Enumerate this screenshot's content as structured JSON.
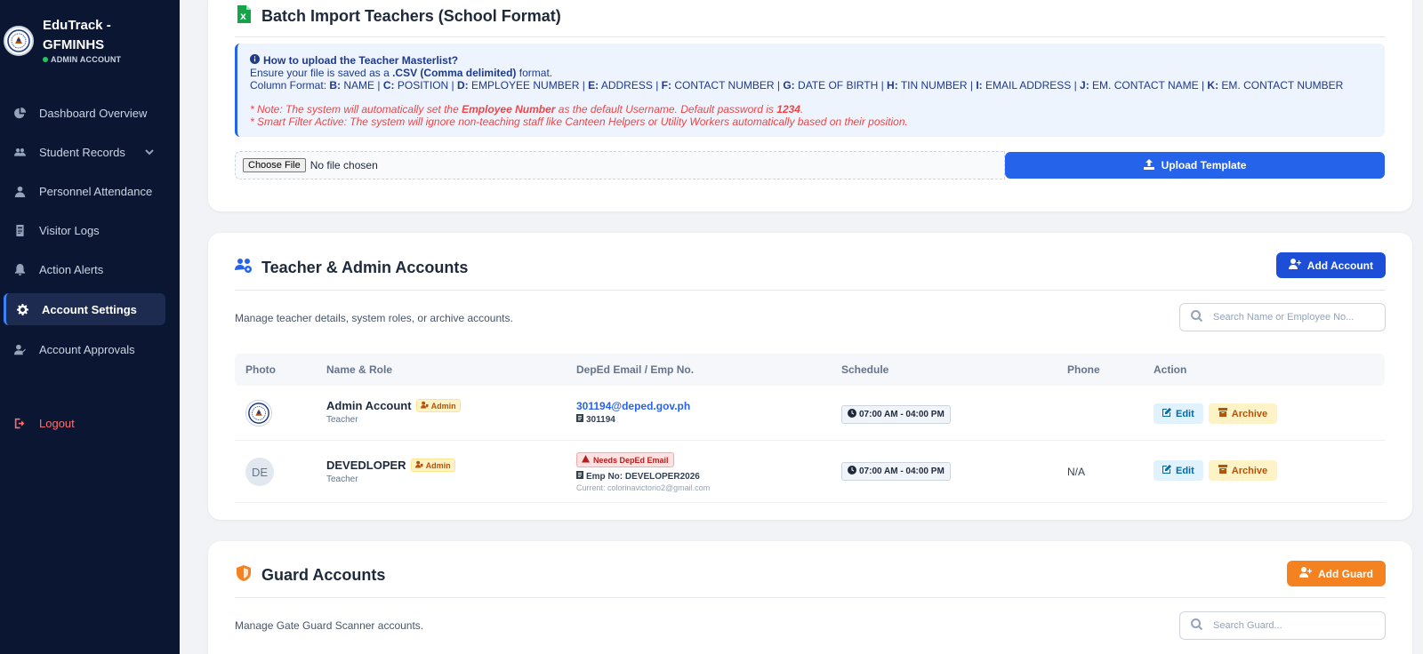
{
  "app": {
    "title": "EduTrack - GFMINHS",
    "account_type": "ADMIN ACCOUNT"
  },
  "sidebar": {
    "items": [
      {
        "label": "Dashboard Overview",
        "icon": "chart-pie-icon"
      },
      {
        "label": "Student Records",
        "icon": "users-icon"
      },
      {
        "label": "Personnel Attendance",
        "icon": "user-icon"
      },
      {
        "label": "Visitor Logs",
        "icon": "id-card-icon"
      },
      {
        "label": "Action Alerts",
        "icon": "bell-icon"
      },
      {
        "label": "Account Settings",
        "icon": "gear-icon"
      },
      {
        "label": "Account Approvals",
        "icon": "user-check-icon"
      }
    ],
    "active": "Account Settings",
    "logout_label": "Logout"
  },
  "batch_import": {
    "title": "Batch Import Teachers (School Format)",
    "help_title": "How to upload the Teacher Masterlist?",
    "ensure_prefix": "Ensure your file is saved as a ",
    "ensure_format": ".CSV (Comma delimited)",
    "ensure_suffix": " format.",
    "column_format_label": "Column Format: ",
    "columns": [
      {
        "letter": "B:",
        "name": " NAME"
      },
      {
        "letter": "C:",
        "name": " POSITION"
      },
      {
        "letter": "D:",
        "name": " EMPLOYEE NUMBER"
      },
      {
        "letter": "E:",
        "name": " ADDRESS"
      },
      {
        "letter": "F:",
        "name": " CONTACT NUMBER"
      },
      {
        "letter": "G:",
        "name": " DATE OF BIRTH"
      },
      {
        "letter": "H:",
        "name": " TIN NUMBER"
      },
      {
        "letter": "I:",
        "name": " EMAIL ADDRESS"
      },
      {
        "letter": "J:",
        "name": " EM. CONTACT NAME"
      },
      {
        "letter": "K:",
        "name": " EM. CONTACT NUMBER"
      }
    ],
    "note1_prefix": "* Note: The system will automatically set the ",
    "note1_bold": "Employee Number",
    "note1_mid": " as the default Username. Default password is ",
    "note1_pw": "1234",
    "note1_end": ".",
    "note2": "* Smart Filter Active: The system will ignore non-teaching staff like Canteen Helpers or Utility Workers automatically based on their position.",
    "file_button": "Choose File",
    "file_status": "No file chosen",
    "upload_label": "Upload Template"
  },
  "teachers": {
    "title": "Teacher & Admin Accounts",
    "add_label": "Add Account",
    "description": "Manage teacher details, system roles, or archive accounts.",
    "search_placeholder": "Search Name or Employee No...",
    "columns": [
      "Photo",
      "Name & Role",
      "DepEd Email / Emp No.",
      "Schedule",
      "Phone",
      "Action"
    ],
    "rows": [
      {
        "name": "Admin Account",
        "badge": "Admin",
        "role": "Teacher",
        "email": "301194@deped.gov.ph",
        "emp": "301194",
        "schedule": "07:00 AM - 04:00 PM",
        "phone": "",
        "edit": "Edit",
        "archive": "Archive"
      },
      {
        "initials": "DE",
        "name": "DEVEDLOPER",
        "badge": "Admin",
        "role": "Teacher",
        "warning": "Needs DepEd Email",
        "emp": "Emp No: DEVELOPER2026",
        "current": "Current: colorinavictorio2@gmail.com",
        "schedule": "07:00 AM - 04:00 PM",
        "phone": "N/A",
        "edit": "Edit",
        "archive": "Archive"
      }
    ]
  },
  "guards": {
    "title": "Guard Accounts",
    "add_label": "Add Guard",
    "description": "Manage Gate Guard Scanner accounts.",
    "search_placeholder": "Search Guard..."
  },
  "colors": {
    "sidebar_bg": "#0b1633",
    "primary": "#1d4ed8",
    "guard_accent": "#f58220",
    "danger": "#ef4444"
  }
}
